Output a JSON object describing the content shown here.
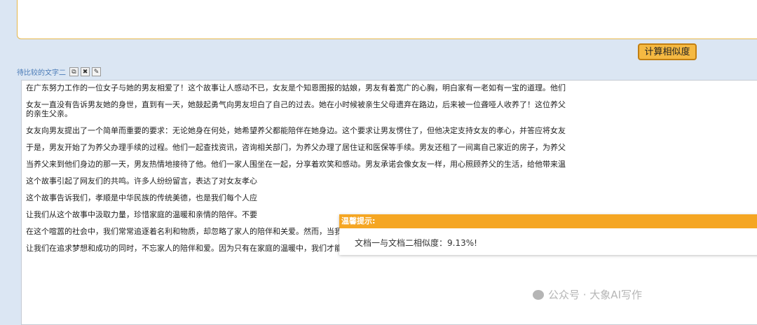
{
  "compare_button": "计算相似度",
  "label": "待比较的文字二",
  "toolbar": {
    "copy": "⧉",
    "clear": "✖",
    "comment": "✎"
  },
  "paragraphs": [
    "在广东努力工作的一位女子与她的男友相爱了！这个故事让人感动不已，女友是个知恩图报的姑娘，男友有着宽广的心胸，明白家有一老如有一宝的道理。他们",
    "女友一直没有告诉男友她的身世，直到有一天，她鼓起勇气向男友坦白了自己的过去。她在小时候被亲生父母遗弃在路边，后来被一位聋哑人收养了！这位养父",
    "的亲生父亲。",
    "女友向男友提出了一个简单而重要的要求：无论她身在何处，她希望养父都能陪伴在她身边。这个要求让男友愣住了，但他决定支持女友的孝心，并答应将女友",
    "于是，男友开始了为养父办理手续的过程。他们一起查找资讯，咨询相关部门，为养父办理了居住证和医保等手续。男友还租了一间离自己家近的房子，为养父",
    "当养父来到他们身边的那一天，男友热情地接待了他。他们一家人围坐在一起，分享着欢笑和感动。男友承诺会像女友一样，用心照顾养父的生活，给他带来温",
    "这个故事引起了网友们的共鸣。许多人纷纷留言，表达了对女友孝心",
    "这个故事告诉我们，孝顺是中华民族的传统美德，也是我们每个人应",
    "让我们从这个故事中汲取力量，珍惜家庭的温暖和亲情的陪伴。不要",
    "在这个喧嚣的社会中，我们常常追逐着名利和物质，却忽略了家人的陪伴和关爱。然而，当我们回首人生时，我们会发现，真正让我们感到幸福和满足的是那些",
    "让我们在追求梦想和成功的同时，不忘家人的陪伴和爱。因为只有在家庭的温暖中，我们才能找到真正的幸福和满足。让我们一起努力，用爱和孝心去温暖这个"
  ],
  "dialog": {
    "title": "温馨提示:",
    "message": "文档一与文档二相似度：9.13%!"
  },
  "watermark": "公众号 · 大象AI写作"
}
